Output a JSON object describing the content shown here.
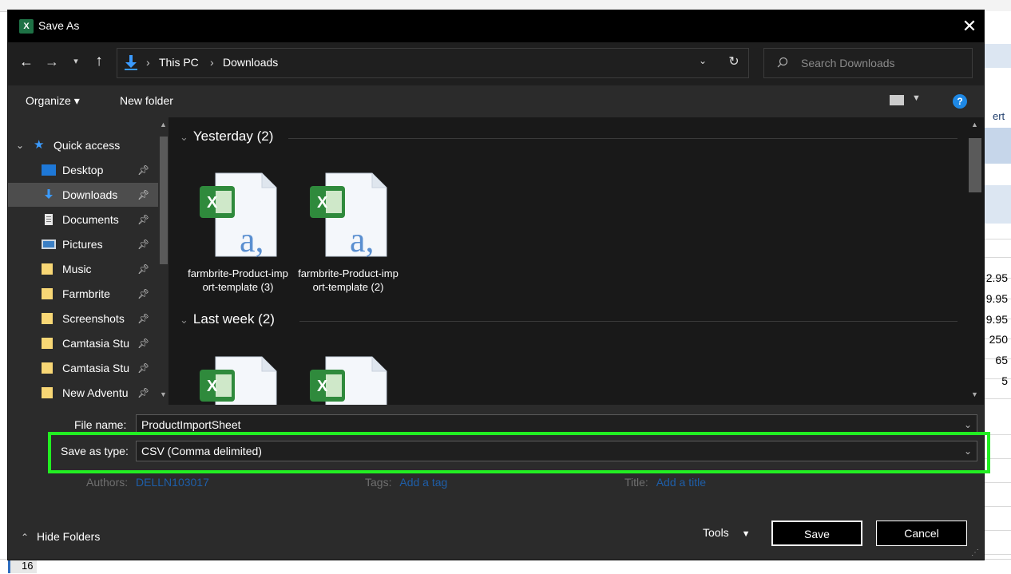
{
  "background": {
    "row_header": "16",
    "cell_values": [
      "2.95",
      "9.95",
      "9.95",
      "250",
      "65",
      "5"
    ],
    "right_edge_text": "ert"
  },
  "dialog": {
    "title": "Save As",
    "app_icon": "excel-icon",
    "address": {
      "crumbs": [
        "This PC",
        "Downloads"
      ],
      "search_placeholder": "Search Downloads"
    },
    "toolbar": {
      "organize": "Organize ▾",
      "new_folder": "New folder"
    },
    "nav": {
      "quick_access": "Quick access",
      "items": [
        {
          "label": "Desktop",
          "icon": "desktop-icon"
        },
        {
          "label": "Downloads",
          "icon": "downloads-icon",
          "selected": true
        },
        {
          "label": "Documents",
          "icon": "documents-icon"
        },
        {
          "label": "Pictures",
          "icon": "pictures-icon"
        },
        {
          "label": "Music",
          "icon": "folder-icon"
        },
        {
          "label": "Farmbrite",
          "icon": "folder-icon"
        },
        {
          "label": "Screenshots",
          "icon": "folder-icon"
        },
        {
          "label": "Camtasia Stu",
          "icon": "folder-icon"
        },
        {
          "label": "Camtasia Stu",
          "icon": "folder-icon"
        },
        {
          "label": "New Adventu",
          "icon": "folder-icon"
        }
      ]
    },
    "groups": [
      {
        "title": "Yesterday (2)",
        "files": [
          "farmbrite-Product-import-template (3)",
          "farmbrite-Product-import-template (2)"
        ]
      },
      {
        "title": "Last week (2)",
        "files": [
          "",
          ""
        ]
      }
    ],
    "form": {
      "file_name_label": "File name:",
      "file_name_value": "ProductImportSheet",
      "save_type_label": "Save as type:",
      "save_type_value": "CSV (Comma delimited)",
      "authors_label": "Authors:",
      "authors_value": "DELLN103017",
      "tags_label": "Tags:",
      "tags_value": "Add a tag",
      "title_label": "Title:",
      "title_value": "Add a title"
    },
    "footer": {
      "hide_folders": "Hide Folders",
      "tools": "Tools",
      "save": "Save",
      "cancel": "Cancel"
    },
    "colors": {
      "highlight": "#22ee22",
      "link": "#1e5ea8",
      "accent": "#1e88e5"
    }
  }
}
